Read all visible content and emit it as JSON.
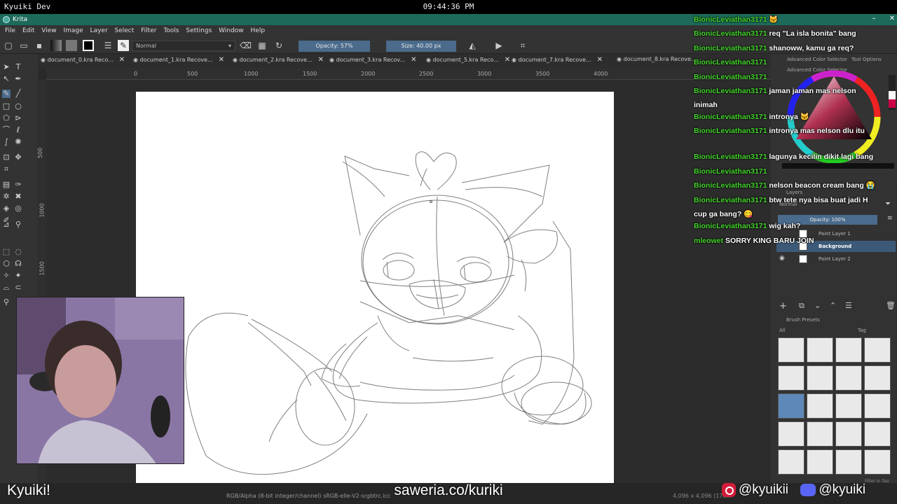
{
  "system": {
    "label": "Kyuiki Dev",
    "clock": "09:44:36 PM"
  },
  "window": {
    "title": "Krita"
  },
  "menu": [
    "File",
    "Edit",
    "View",
    "Image",
    "Layer",
    "Select",
    "Filter",
    "Tools",
    "Settings",
    "Window",
    "Help"
  ],
  "toolbar": {
    "blend_mode": "Normal",
    "opacity": "Opacity: 57%",
    "size": "Size: 40.00 px"
  },
  "tabs": [
    "document_0.kra Reco...",
    "document_1.kra Recove...",
    "document_2.kra Recove...",
    "document_3.kra Recov...",
    "document_5.kra Reco...",
    "document_7.kra Recove...",
    "document_8.kra Recove..."
  ],
  "ruler_h": [
    "0",
    "500",
    "1000",
    "1500",
    "2000",
    "2500",
    "3000",
    "3500",
    "4000"
  ],
  "ruler_v": [
    "500",
    "1000",
    "1500"
  ],
  "status": {
    "info": "RGB/Alpha (8-bit integer/channel)  sRGB-elle-V2-srgbtrc.icc",
    "size": "4,096 x 4,096 (178..."
  },
  "dockers": {
    "color_tab": "Advanced Color Selector",
    "tool_options_tab": "Tool Options",
    "color_title": "Advanced Color Selector",
    "layers_title": "Layers",
    "layers_mode": "Normal",
    "layers_opacity": "Opacity: 100%",
    "layers": [
      {
        "name": "Paint Layer 1",
        "selected": false
      },
      {
        "name": "Background",
        "selected": true
      },
      {
        "name": "Paint Layer 2",
        "selected": false
      }
    ],
    "brush_title": "Brush Presets",
    "brush_filter": "All",
    "brush_tag": "Tag",
    "brush_footer": "Filter in Tag"
  },
  "chat": [
    {
      "user": "BionicLeviathan3171",
      "text": "🐱"
    },
    {
      "user": "BionicLeviathan3171",
      "text": "req \"La isla bonita\" bang"
    },
    {
      "user": "BionicLeviathan3171",
      "text": "shanoww, kamu ga req?"
    },
    {
      "user": "BionicLeviathan3171",
      "text": ""
    },
    {
      "user": "BionicLeviathan3171",
      "text": ""
    },
    {
      "user": "BionicLeviathan3171",
      "text": "jaman jaman mas nelson",
      "text2": "inimah"
    },
    {
      "user": "BionicLeviathan3171",
      "text": "intronya 🐱"
    },
    {
      "user": "BionicLeviathan3171",
      "text": "intronya mas nelson dlu itu",
      "text2": ""
    },
    {
      "user": "BionicLeviathan3171",
      "text": "lagunya kecilin dikit lagi bang"
    },
    {
      "user": "BionicLeviathan3171",
      "text": ""
    },
    {
      "user": "BionicLeviathan3171",
      "text": "nelson beacon cream bang 😭"
    },
    {
      "user": "BionicLeviathan3171",
      "text": "btw tete nya bisa buat jadi H",
      "text2": "cup ga bang? 😋"
    },
    {
      "user": "BionicLeviathan3171",
      "text": "wig kah?"
    },
    {
      "user": "mleowet",
      "text": "SORRY KING BARU JOIN"
    }
  ],
  "overlay": {
    "name": "Kyuiki!",
    "saweria": "saweria.co/kuriki",
    "instagram": "@kyuikii",
    "discord": "@kyuiki"
  },
  "colors": {
    "accent": "#4a6b8c",
    "titlebar": "#1d6a5a",
    "chat_user": "#44d62c"
  }
}
